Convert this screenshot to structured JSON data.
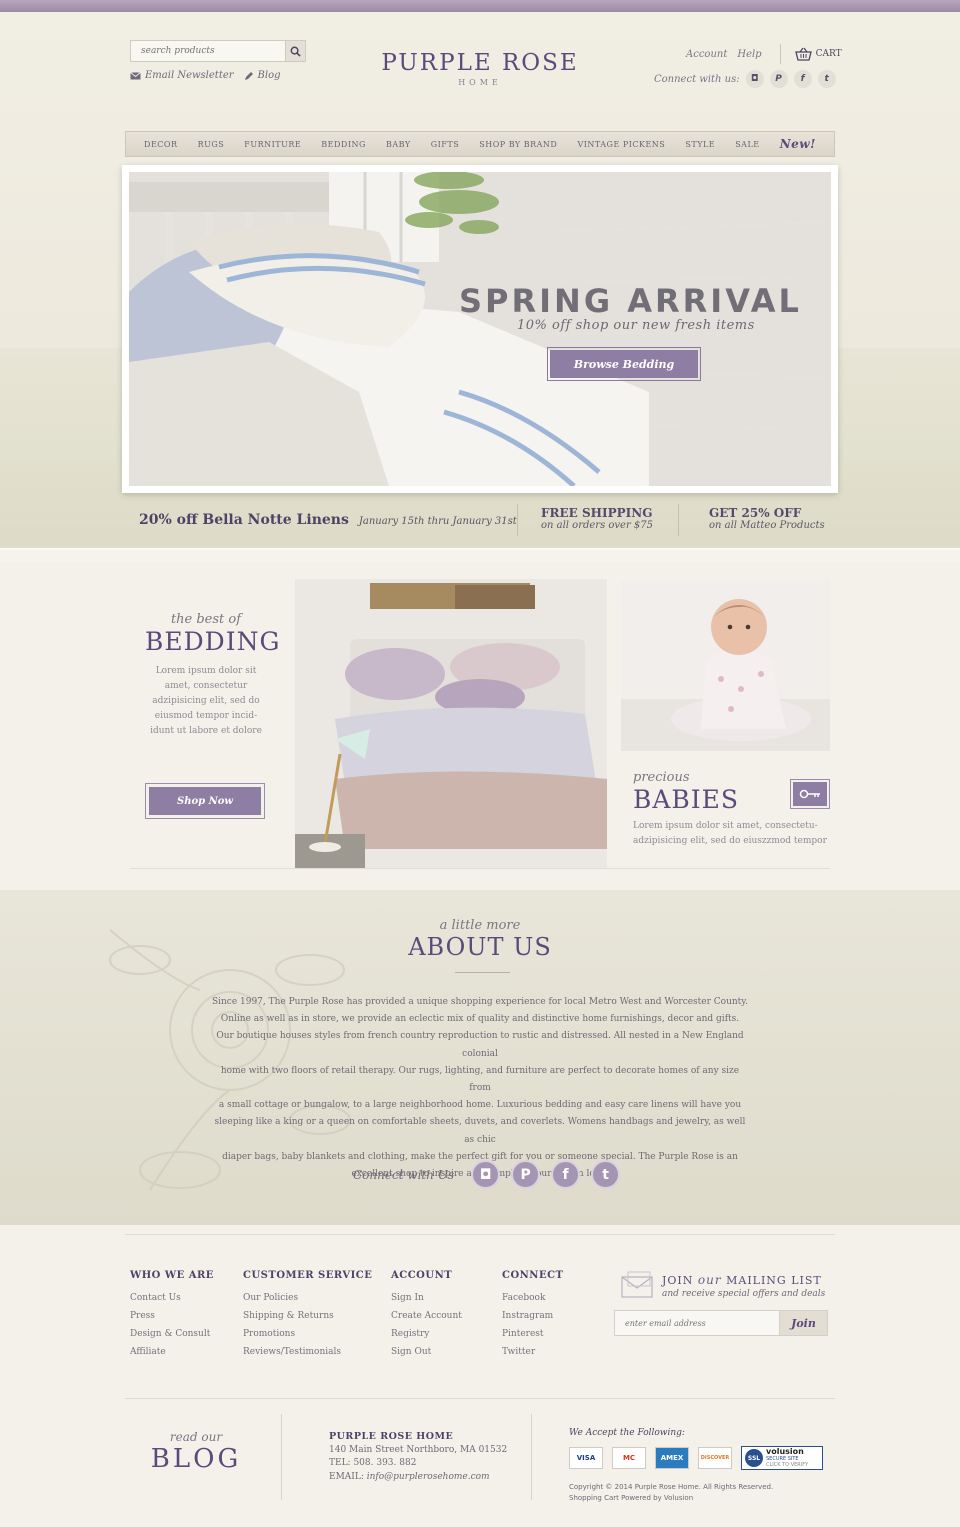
{
  "header": {
    "search_placeholder": "search products",
    "email_newsletter": "Email Newsletter",
    "blog": "Blog",
    "logo_main": "PURPLE ROSE",
    "logo_sub": "HOME",
    "account": "Account",
    "help": "Help",
    "cart": "CART",
    "connect_label": "Connect with us:"
  },
  "nav": {
    "items": [
      "DECOR",
      "RUGS",
      "FURNITURE",
      "BEDDING",
      "BABY",
      "GIFTS",
      "SHOP BY BRAND",
      "VINTAGE PICKENS",
      "STYLE",
      "SALE"
    ],
    "new_label": "New!"
  },
  "hero": {
    "title": "SPRING ARRIVAL",
    "subtitle": "10% off shop our new fresh items",
    "button": "Browse Bedding"
  },
  "promos": {
    "p1_big": "20% off Bella Notte Linens",
    "p1_small": "January 15th thru January 31st",
    "p2_big": "FREE SHIPPING",
    "p2_small": "on all orders over $75",
    "p3_big": "GET 25% OFF",
    "p3_small": "on all Matteo Products"
  },
  "features": {
    "bedding_kicker": "the best of",
    "bedding_title": "BEDDING",
    "bedding_text": "Lorem ipsum dolor sit amet, consectetur adzipisicing elit, sed do eiusmod tempor incid-idunt ut labore et dolore",
    "shop_now": "Shop Now",
    "babies_kicker": "precious",
    "babies_title": "BABIES",
    "babies_text": "Lorem ipsum dolor sit amet, consectetu-adzipisicing elit, sed do eiuszzmod tempor"
  },
  "about": {
    "kicker": "a little more",
    "title": "ABOUT US",
    "lines": [
      "Since 1997, The Purple Rose has provided a unique shopping experience for local Metro West and Worcester County.",
      "Online as well as in store, we provide an eclectic mix of quality and distinctive home furnishings, decor and gifts.",
      "Our boutique houses styles from french country reproduction to rustic and distressed. All nested in a New England colonial",
      "home with two floors of retail therapy. Our rugs, lighting, and furniture are perfect to decorate homes of any size from",
      "a small cottage or bungalow, to a large neighborhood home. Luxurious bedding and easy care linens will have you",
      "sleeping like a king or a queen on comfortable sheets, duvets, and coverlets. Womens handbags and jewelry, as well as chic",
      "diaper bags, baby blankets and clothing, make the perfect gift for you or someone special. The Purple Rose is an",
      "excellent shop to inspire and complete your dream look."
    ],
    "connect_label": "Connect with Us"
  },
  "footer": {
    "cols": [
      {
        "title": "WHO WE ARE",
        "links": [
          "Contact Us",
          "Press",
          "Design & Consult",
          "Affiliate"
        ]
      },
      {
        "title": "CUSTOMER SERVICE",
        "links": [
          "Our Policies",
          "Shipping & Returns",
          "Promotions",
          "Reviews/Testimonials"
        ]
      },
      {
        "title": "ACCOUNT",
        "links": [
          "Sign In",
          "Create Account",
          "Registry",
          "Sign Out"
        ]
      },
      {
        "title": "CONNECT",
        "links": [
          "Facebook",
          "Instragram",
          "Pinterest",
          "Twitter"
        ]
      }
    ],
    "mailing_a": "JOIN",
    "mailing_b": "our",
    "mailing_c": "MAILING LIST",
    "mailing_sub": "and receive special offers and deals",
    "email_placeholder": "enter email address",
    "join": "Join",
    "blog_read": "read our",
    "blog_title": "BLOG",
    "company": "PURPLE ROSE HOME",
    "address": "140 Main Street Northboro, MA  01532",
    "tel": "TEL: 508. 393. 882",
    "email_label": "EMAIL:",
    "email": "info@purplerosehome.com",
    "accept": "We Accept the Following:",
    "cards": [
      "VISA",
      "MC",
      "AMEX",
      "DISCOVER"
    ],
    "ssl_badge": "SSL",
    "ssl_brand": "volusion",
    "ssl_secure": "SECURE SITE",
    "ssl_verify": "CLICK TO VERIFY",
    "copyright": "Copyright © 2014 Purple Rose Home. All Rights Reserved.",
    "powered": "Shopping Cart Powered by Volusion"
  },
  "colors": {
    "accent": "#5c4a7a",
    "button": "#8f7ea3",
    "background": "#f3f1ea"
  }
}
